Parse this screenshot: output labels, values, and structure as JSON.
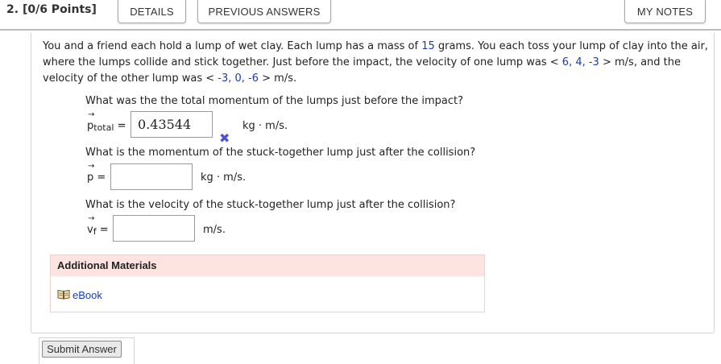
{
  "header": {
    "question_number": "2.",
    "points": "[0/6 Points]",
    "details_label": "DETAILS",
    "previous_answers_label": "PREVIOUS ANSWERS",
    "my_notes_label": "MY NOTES"
  },
  "problem": {
    "part1": "You and a friend each hold a lump of wet clay. Each lump has a mass of ",
    "mass_value": "15",
    "part2": " grams. You each toss your lump of clay into the air, where the lumps collide and stick together. Just before the impact, the velocity of one lump was < ",
    "v1_value": "6, 4, -3",
    "part3": " > m/s, and the velocity of the other lump was < ",
    "v2_value": "-3, 0, -6",
    "part4": " > m/s."
  },
  "questions": [
    {
      "text": "What was the the total momentum of the lumps just before the impact?",
      "symbol": "p",
      "subscript": "total",
      "equals": "=",
      "answer_value": "0.43544",
      "unit": "kg · m/s.",
      "status_icon": "x-mark-icon",
      "status_color": "#4b53d6"
    },
    {
      "text": "What is the momentum of the stuck-together lump just after the collision?",
      "symbol": "p",
      "subscript": "",
      "equals": "=",
      "answer_value": "",
      "unit": "kg · m/s."
    },
    {
      "text": "What is the velocity of the stuck-together lump just after the collision?",
      "symbol": "v",
      "subscript": "f",
      "equals": "=",
      "answer_value": "",
      "unit": "m/s."
    }
  ],
  "additional_materials": {
    "title": "Additional Materials",
    "ebook_label": "eBook",
    "ebook_icon": "book-icon"
  },
  "submit_label": "Submit Answer",
  "colors": {
    "highlight_blue": "#1a3bb5",
    "header_pink": "#fde4e1"
  }
}
